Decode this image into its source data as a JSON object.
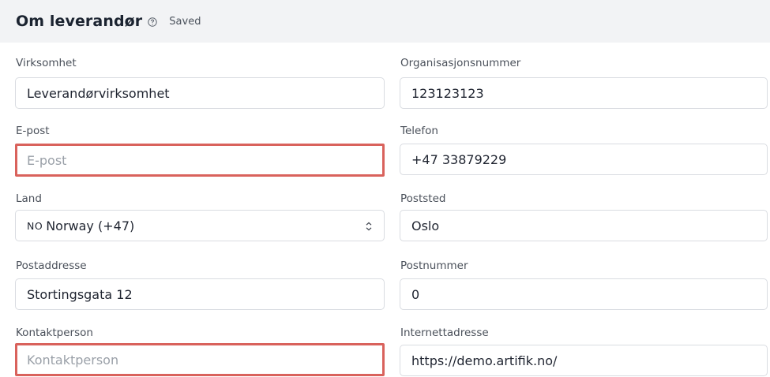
{
  "header": {
    "title": "Om leverandør",
    "status": "Saved"
  },
  "fields": {
    "virksomhet": {
      "label": "Virksomhet",
      "value": "Leverandørvirksomhet"
    },
    "organisasjonsnummer": {
      "label": "Organisasjonsnummer",
      "value": "123123123"
    },
    "epost": {
      "label": "E-post",
      "value": "",
      "placeholder": "E-post"
    },
    "telefon": {
      "label": "Telefon",
      "value": "+47 33879229"
    },
    "land": {
      "label": "Land",
      "flag_code": "NO",
      "value": "Norway (+47)"
    },
    "poststed": {
      "label": "Poststed",
      "value": "Oslo"
    },
    "postaddresse": {
      "label": "Postaddresse",
      "value": "Stortingsgata 12"
    },
    "postnummer": {
      "label": "Postnummer",
      "value": "0"
    },
    "kontaktperson": {
      "label": "Kontaktperson",
      "value": "",
      "placeholder": "Kontaktperson"
    },
    "internettadresse": {
      "label": "Internettadresse",
      "value": "https://demo.artifik.no/"
    }
  },
  "colors": {
    "header_bg": "#f2f3f5",
    "error_border": "#d9625c",
    "input_border": "#d9dce1"
  },
  "icons": {
    "help": "question-circle-icon",
    "select": "chevron-up-down-icon"
  }
}
